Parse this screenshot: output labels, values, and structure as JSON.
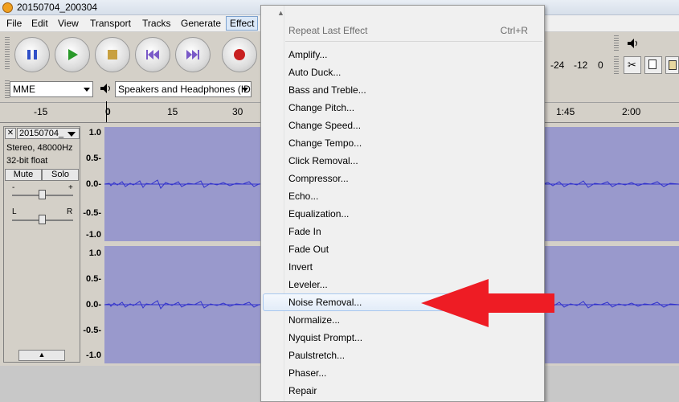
{
  "window": {
    "title": "20150704_200304"
  },
  "menubar": {
    "items": [
      "File",
      "Edit",
      "View",
      "Transport",
      "Tracks",
      "Generate",
      "Effect"
    ],
    "active": "Effect"
  },
  "device": {
    "host": "MME",
    "output": "Speakers and Headphones (ID"
  },
  "meters": {
    "labels": [
      "-24",
      "-12",
      "0"
    ]
  },
  "ruler": {
    "labels": [
      "-15",
      "0",
      "15",
      "30",
      "1:45",
      "2:00"
    ]
  },
  "track": {
    "name": "20150704_",
    "info1": "Stereo, 48000Hz",
    "info2": "32-bit float",
    "mute_label": "Mute",
    "solo_label": "Solo",
    "gain_minus": "-",
    "gain_plus": "+",
    "pan_left": "L",
    "pan_right": "R",
    "close_glyph": "✕",
    "collapse_glyph": "▲"
  },
  "scale": {
    "channel1": [
      "1.0",
      "0.5-",
      "0.0-",
      "-0.5-",
      "-1.0"
    ],
    "channel2": [
      "1.0",
      "0.5-",
      "0.0-",
      "-0.5-",
      "-1.0"
    ]
  },
  "effect_menu": {
    "repeat_label": "Repeat Last Effect",
    "repeat_shortcut": "Ctrl+R",
    "items": [
      "Amplify...",
      "Auto Duck...",
      "Bass and Treble...",
      "Change Pitch...",
      "Change Speed...",
      "Change Tempo...",
      "Click Removal...",
      "Compressor...",
      "Echo...",
      "Equalization...",
      "Fade In",
      "Fade Out",
      "Invert",
      "Leveler...",
      "Noise Removal...",
      "Normalize...",
      "Nyquist Prompt...",
      "Paulstretch...",
      "Phaser...",
      "Repair"
    ],
    "highlighted": "Noise Removal..."
  },
  "colors": {
    "waveform_bg": "#9999cc",
    "waveform": "#3333cc",
    "arrow": "#ee1c24",
    "menu_highlight": "#dbe8f7"
  },
  "icons": [
    "pause-icon",
    "play-icon",
    "stop-icon",
    "skip-start-icon",
    "skip-end-icon",
    "record-icon",
    "speaker-icon",
    "scroll-up-icon",
    "red-arrow"
  ]
}
